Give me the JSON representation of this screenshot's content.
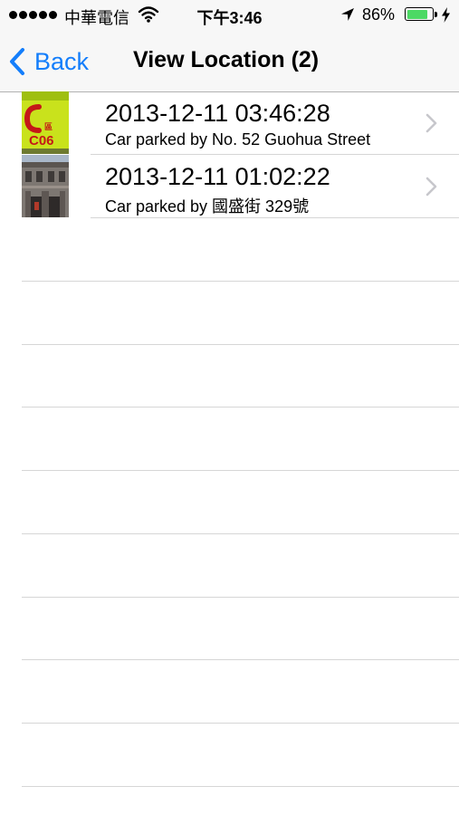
{
  "status_bar": {
    "carrier": "中華電信",
    "time": "下午3:46",
    "battery_percent": "86%",
    "battery_level": 0.86,
    "battery_color": "#4cd964"
  },
  "nav": {
    "back_label": "Back",
    "title": "View Location (2)",
    "tint_color": "#147efb"
  },
  "locations": [
    {
      "timestamp": "2013-12-11 03:46:28",
      "description": "Car parked by No. 52 Guohua Street",
      "thumbnail": {
        "kind": "parking-sign-photo",
        "sign_text": "C06"
      }
    },
    {
      "timestamp": "2013-12-11 01:02:22",
      "description": "Car parked by 國盛街 329號",
      "thumbnail": {
        "kind": "building-photo"
      }
    }
  ],
  "icons": {
    "status_bar": [
      "signal-dots-icon",
      "wifi-icon",
      "location-arrow-icon",
      "battery-icon",
      "charging-bolt-icon"
    ],
    "nav": [
      "back-chevron-icon"
    ],
    "rows": [
      "disclosure-chevron-icon"
    ]
  }
}
